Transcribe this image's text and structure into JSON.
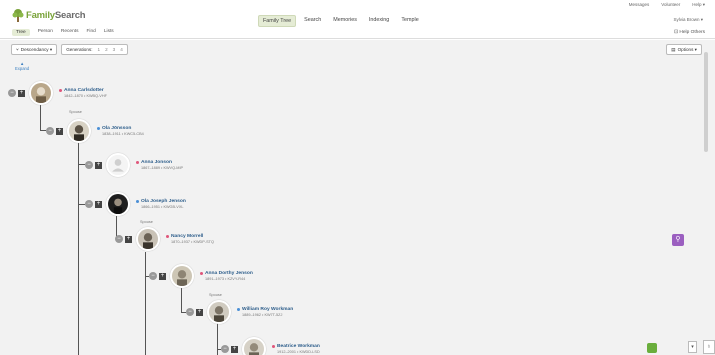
{
  "header": {
    "logo_family": "Family",
    "logo_search": "Search",
    "top_links": [
      "Messages",
      "Volunteer",
      "Help ▾"
    ],
    "main_nav": [
      "Family Tree",
      "Search",
      "Memories",
      "Indexing",
      "Temple"
    ],
    "user": "Sylvia Brown ▾"
  },
  "subnav": {
    "tabs": [
      "Tree",
      "Person",
      "Recents",
      "Find",
      "Lists"
    ],
    "help_others": "Help Others"
  },
  "toolbar": {
    "view": "Descendancy ▾",
    "generations_label": "Generations:",
    "generations": [
      "1",
      "2",
      "3",
      "4"
    ],
    "options": "Options ▾"
  },
  "expand_label": "Expand",
  "spouse_label": "Spouse",
  "people": [
    {
      "name": "Anna Carlsdotter",
      "dates": "1842–1870 • KWBQ-VHF",
      "gender_color": "#e0567a"
    },
    {
      "name": "Ola Jönsson",
      "dates": "1838–1911 • KWC5-CB4",
      "gender_color": "#4a8fd6"
    },
    {
      "name": "Anna Jonson",
      "dates": "1867–1889 • KWVQ-MIP",
      "gender_color": "#e0567a"
    },
    {
      "name": "Ola Joseph Jenson",
      "dates": "1866–1951 • KWGB-VXL",
      "gender_color": "#4a8fd6"
    },
    {
      "name": "Nancy Morrell",
      "dates": "1870–1937 • KWDP-STQ",
      "gender_color": "#e0567a"
    },
    {
      "name": "Anna Dorthy Jenson",
      "dates": "1891–1973 • KZVY-R44",
      "gender_color": "#e0567a"
    },
    {
      "name": "William Roy Workman",
      "dates": "1889–1962 • KW7T-5ZJ",
      "gender_color": "#4a8fd6"
    },
    {
      "name": "Beatrice Workman",
      "dates": "1912–2001 • KWDD-LSD",
      "gender_color": "#e0567a"
    }
  ]
}
